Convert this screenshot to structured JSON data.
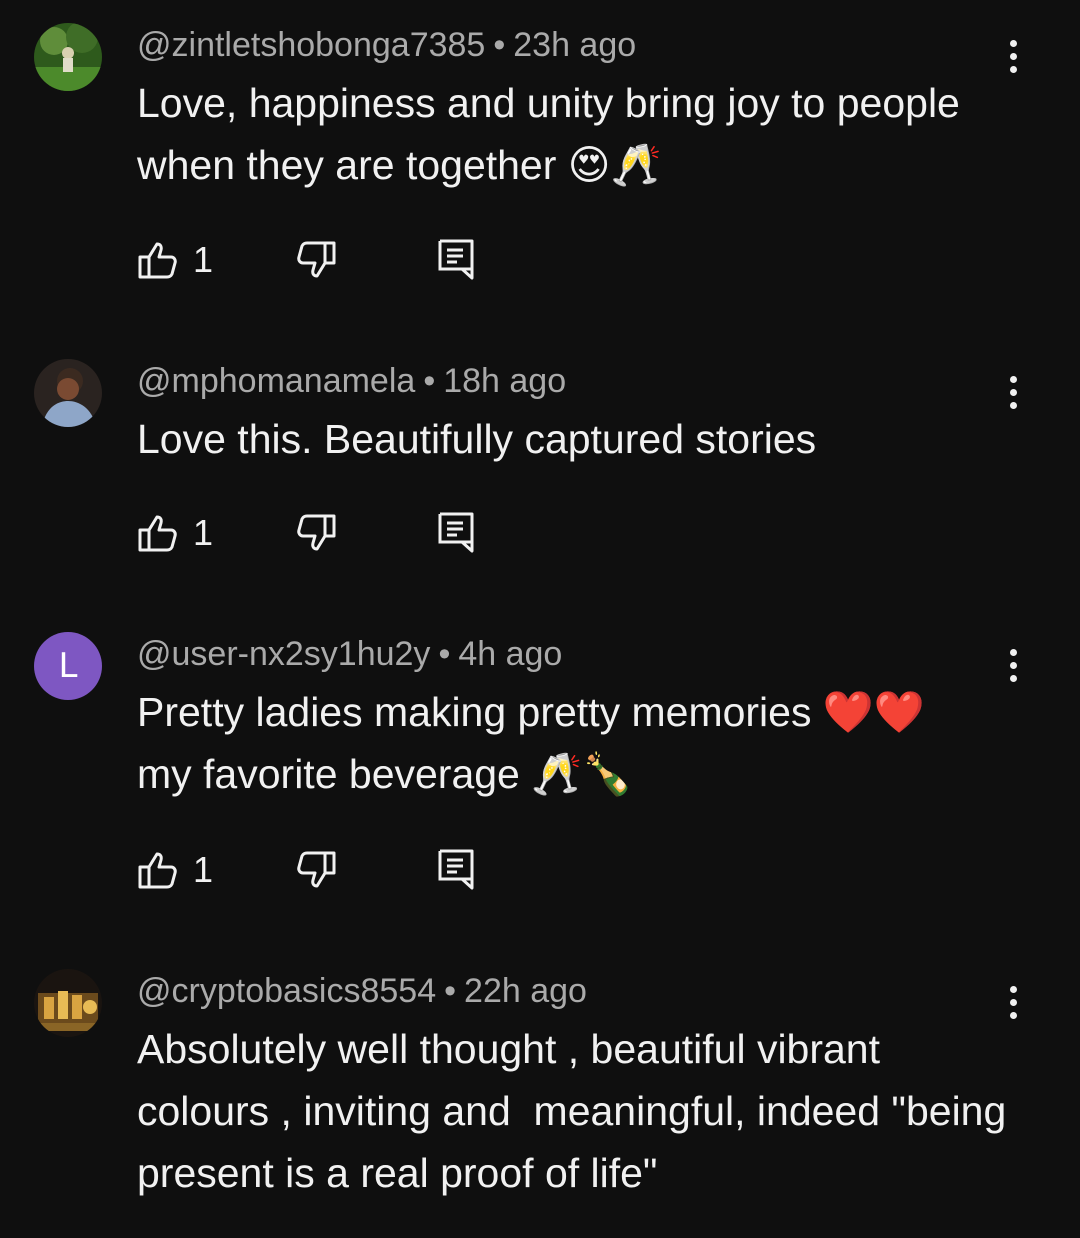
{
  "comments": [
    {
      "username": "@zintletshobonga7385",
      "time": "23h ago",
      "text": "Love, happiness and unity bring joy to people when they are together 😍🥂",
      "likes": "1",
      "avatar_letter": ""
    },
    {
      "username": "@mphomanamela",
      "time": "18h ago",
      "text": "Love this. Beautifully captured stories",
      "likes": "1",
      "avatar_letter": ""
    },
    {
      "username": "@user-nx2sy1hu2y",
      "time": "4h ago",
      "text": "Pretty ladies making pretty memories ❤️❤️\nmy favorite beverage 🥂🍾",
      "likes": "1",
      "avatar_letter": "L"
    },
    {
      "username": "@cryptobasics8554",
      "time": "22h ago",
      "text": "Absolutely well thought , beautiful vibrant colours , inviting and  meaningful, indeed \"being present is a real proof of life\"",
      "likes": "",
      "avatar_letter": ""
    }
  ],
  "separator": "•",
  "colors": {
    "background": "#0f0f0f",
    "text": "#f1f1f1",
    "meta": "#aaaaaa",
    "avatar_letter_bg": "#7e57c2"
  },
  "icons": [
    "like-icon",
    "dislike-icon",
    "reply-icon",
    "more-vert-icon"
  ]
}
